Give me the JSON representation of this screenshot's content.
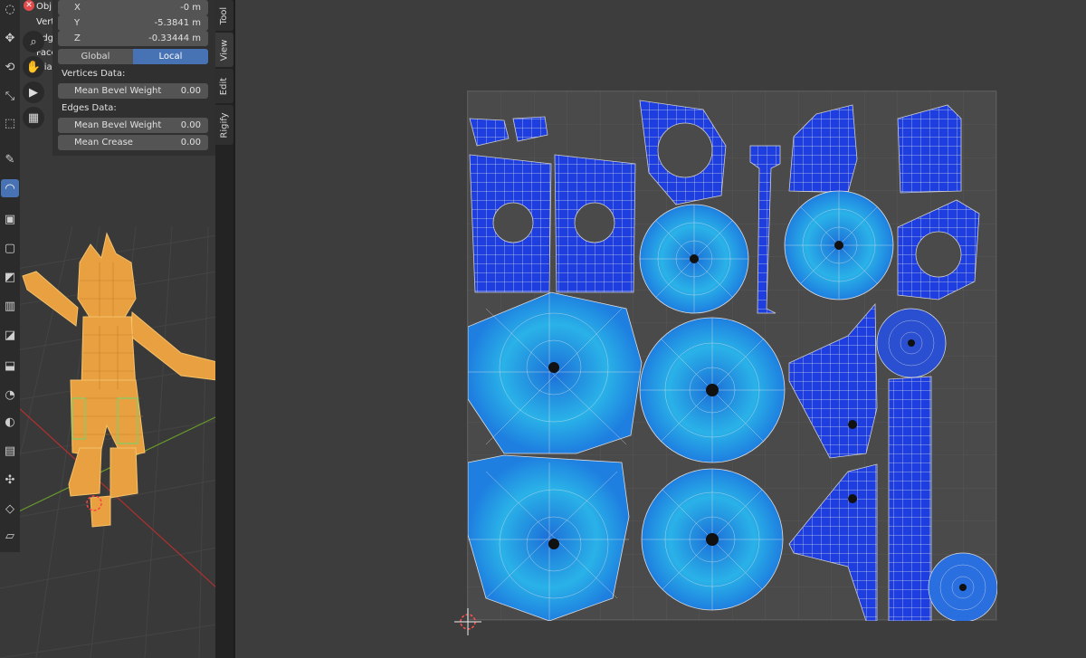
{
  "stats": {
    "objects": "Obj",
    "vertices": "Vert",
    "edges": "Edg",
    "faces": "Face",
    "triangles": "Tria"
  },
  "transform": {
    "x_label": "X",
    "x_value": "-0 m",
    "y_label": "Y",
    "y_value": "-5.3841 m",
    "z_label": "Z",
    "z_value": "-0.33444 m"
  },
  "space": {
    "global": "Global",
    "local": "Local",
    "selected": "Local"
  },
  "vertices_data": {
    "title": "Vertices Data:",
    "bevel_label": "Mean Bevel Weight",
    "bevel_value": "0.00"
  },
  "edges_data": {
    "title": "Edges Data:",
    "bevel_label": "Mean Bevel Weight",
    "bevel_value": "0.00",
    "crease_label": "Mean Crease",
    "crease_value": "0.00"
  },
  "tabs": [
    "Tool",
    "View",
    "Edit",
    "Rigify"
  ],
  "colors": {
    "accent": "#4772b3",
    "selection_orange": "#f0a030",
    "uv_blue": "#1e3ee0",
    "uv_cyan": "#2fb6e6"
  },
  "icons": {
    "close": "close-icon",
    "zoom": "zoom-icon",
    "pan": "hand-icon",
    "camera": "camera-icon",
    "grid": "grid-icon"
  }
}
